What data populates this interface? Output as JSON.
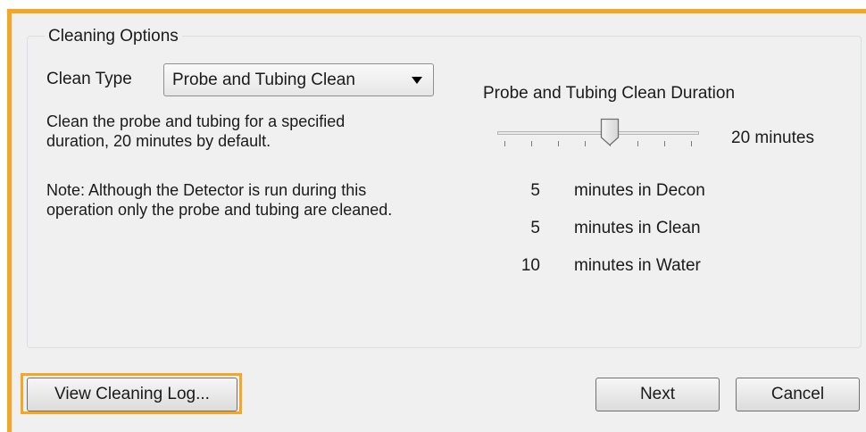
{
  "group": {
    "title": "Cleaning Options"
  },
  "clean_type": {
    "label": "Clean Type",
    "selected": "Probe and Tubing Clean"
  },
  "description": {
    "line1": "Clean the probe and tubing for a specified",
    "line2": "duration, 20 minutes by default.",
    "note1": "Note: Although the Detector is run during this",
    "note2": "operation only the probe and tubing are cleaned."
  },
  "duration": {
    "title": "Probe and Tubing Clean Duration",
    "value_label": "20 minutes",
    "slider_fraction": 0.5
  },
  "breakdown": [
    {
      "amount": "5",
      "label": "minutes in Decon"
    },
    {
      "amount": "5",
      "label": "minutes in Clean"
    },
    {
      "amount": "10",
      "label": "minutes in Water"
    }
  ],
  "buttons": {
    "view_log": "View Cleaning Log...",
    "next": "Next",
    "cancel": "Cancel"
  },
  "colors": {
    "highlight": "#f5a623"
  }
}
